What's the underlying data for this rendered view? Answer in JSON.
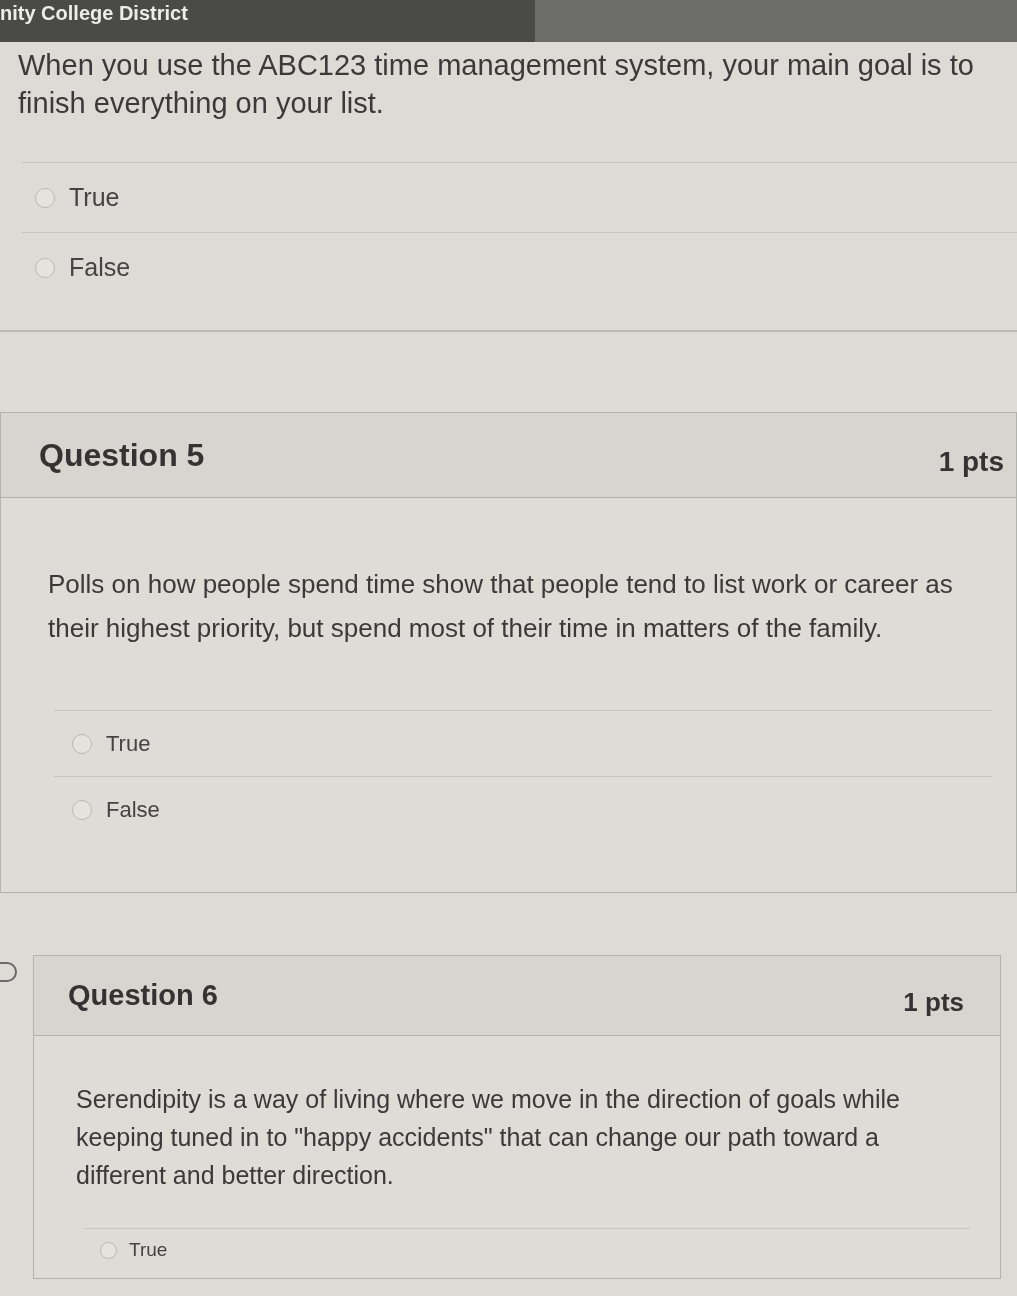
{
  "title_bar": {
    "title": "nity College District"
  },
  "previous_question": {
    "text": "When you use the ABC123 time management system, your main goal is to finish everything on your list.",
    "answers": [
      {
        "label": "True",
        "selected": false
      },
      {
        "label": "False",
        "selected": false
      }
    ]
  },
  "questions": [
    {
      "title": "Question 5",
      "points": "1 pts",
      "text": "Polls on how people spend time show that people tend to list work or career as their highest priority, but spend most of their time in matters of the family.",
      "answers": [
        {
          "label": "True",
          "selected": false
        },
        {
          "label": "False",
          "selected": false
        }
      ]
    },
    {
      "title": "Question 6",
      "points": "1 pts",
      "text": "Serendipity is a way of living where we move in the direction of goals while keeping tuned in to \"happy accidents\" that can change our path toward a different and better direction.",
      "answers": [
        {
          "label": "True",
          "selected": false
        }
      ]
    }
  ]
}
